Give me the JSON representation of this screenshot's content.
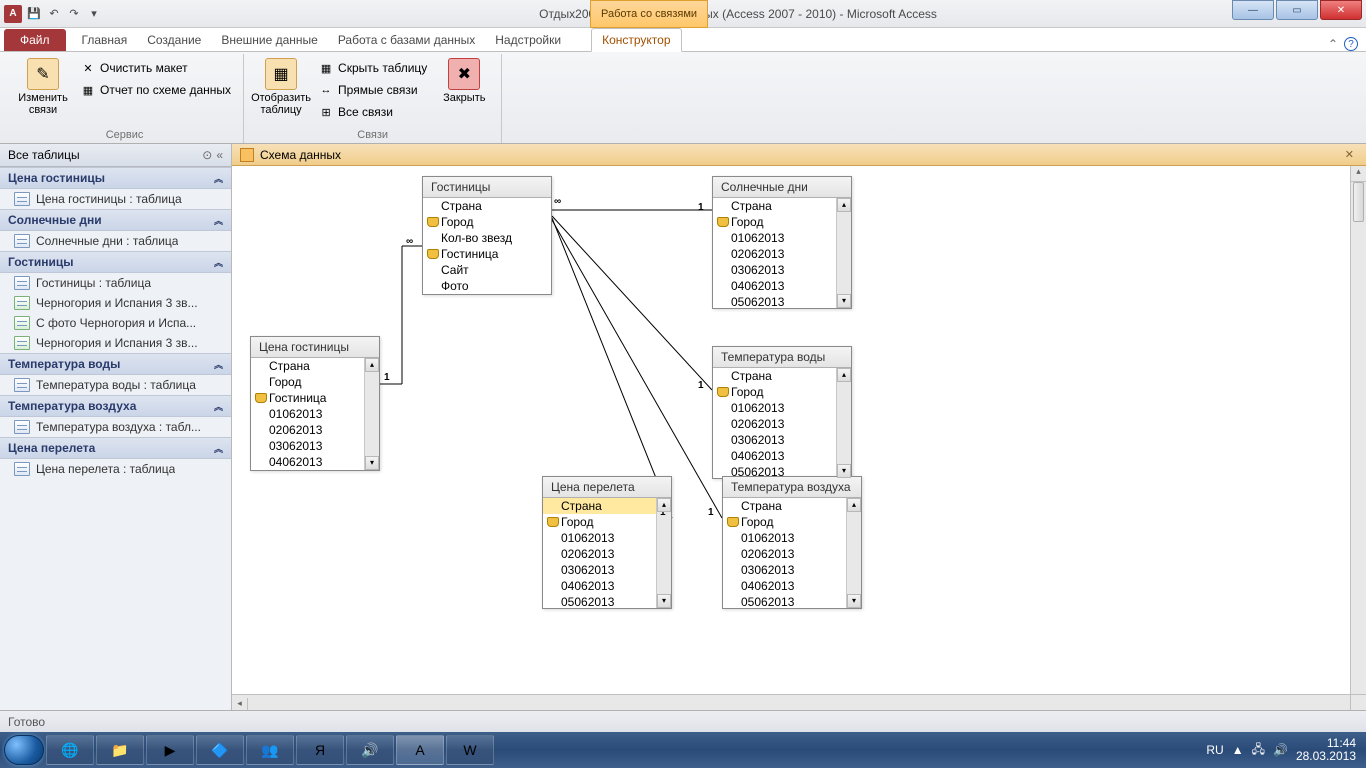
{
  "titlebar": {
    "app_letter": "A",
    "title": "Отдых2007 28_03 : база данных (Access 2007 - 2010)  -  Microsoft Access",
    "context_group": "Работа со связями"
  },
  "win_controls": {
    "min": "—",
    "max": "▭",
    "close": "✕"
  },
  "ribbon_tabs": {
    "file": "Файл",
    "tabs": [
      "Главная",
      "Создание",
      "Внешние данные",
      "Работа с базами данных",
      "Надстройки"
    ],
    "active": "Конструктор"
  },
  "ribbon": {
    "group1_label": "Сервис",
    "edit_rel": "Изменить\nсвязи",
    "clear_layout": "Очистить макет",
    "rel_report": "Отчет по схеме данных",
    "group2_label": "Связи",
    "show_table": "Отобразить\nтаблицу",
    "hide_table": "Скрыть таблицу",
    "direct_rel": "Прямые связи",
    "all_rel": "Все связи",
    "close": "Закрыть"
  },
  "navpane": {
    "header": "Все таблицы",
    "groups": [
      {
        "title": "Цена гостиницы",
        "items": [
          {
            "t": "t",
            "label": "Цена гостиницы : таблица"
          }
        ]
      },
      {
        "title": "Солнечные дни",
        "items": [
          {
            "t": "t",
            "label": "Солнечные дни : таблица"
          }
        ]
      },
      {
        "title": "Гостиницы",
        "items": [
          {
            "t": "t",
            "label": "Гостиницы : таблица"
          },
          {
            "t": "q",
            "label": "Черногория и Испания 3 зв..."
          },
          {
            "t": "q",
            "label": "С фото Черногория и Испа..."
          },
          {
            "t": "q",
            "label": "Черногория и Испания 3 зв..."
          }
        ]
      },
      {
        "title": "Температура воды",
        "items": [
          {
            "t": "t",
            "label": "Температура воды : таблица"
          }
        ]
      },
      {
        "title": "Температура воздуха",
        "items": [
          {
            "t": "t",
            "label": "Температура воздуха : табл..."
          }
        ]
      },
      {
        "title": "Цена перелета",
        "items": [
          {
            "t": "t",
            "label": "Цена перелета : таблица"
          }
        ]
      }
    ]
  },
  "doc_tab": "Схема данных",
  "tables": {
    "hostels": {
      "title": "Гостиницы",
      "fields": [
        {
          "n": "Страна",
          "k": false
        },
        {
          "n": "Город",
          "k": true
        },
        {
          "n": "Кол-во звезд",
          "k": false
        },
        {
          "n": "Гостиница",
          "k": true
        },
        {
          "n": "Сайт",
          "k": false
        },
        {
          "n": "Фото",
          "k": false
        }
      ]
    },
    "sunny": {
      "title": "Солнечные дни",
      "fields": [
        {
          "n": "Страна",
          "k": false
        },
        {
          "n": "Город",
          "k": true
        },
        {
          "n": "01062013",
          "k": false
        },
        {
          "n": "02062013",
          "k": false
        },
        {
          "n": "03062013",
          "k": false
        },
        {
          "n": "04062013",
          "k": false
        },
        {
          "n": "05062013",
          "k": false
        }
      ]
    },
    "price": {
      "title": "Цена гостиницы",
      "fields": [
        {
          "n": "Страна",
          "k": false
        },
        {
          "n": "Город",
          "k": false
        },
        {
          "n": "Гостиница",
          "k": true
        },
        {
          "n": "01062013",
          "k": false
        },
        {
          "n": "02062013",
          "k": false
        },
        {
          "n": "03062013",
          "k": false
        },
        {
          "n": "04062013",
          "k": false
        }
      ]
    },
    "water": {
      "title": "Температура воды",
      "fields": [
        {
          "n": "Страна",
          "k": false
        },
        {
          "n": "Город",
          "k": true
        },
        {
          "n": "01062013",
          "k": false
        },
        {
          "n": "02062013",
          "k": false
        },
        {
          "n": "03062013",
          "k": false
        },
        {
          "n": "04062013",
          "k": false
        },
        {
          "n": "05062013",
          "k": false
        }
      ]
    },
    "flight": {
      "title": "Цена перелета",
      "fields": [
        {
          "n": "Страна",
          "k": false,
          "sel": true
        },
        {
          "n": "Город",
          "k": true
        },
        {
          "n": "01062013",
          "k": false
        },
        {
          "n": "02062013",
          "k": false
        },
        {
          "n": "03062013",
          "k": false
        },
        {
          "n": "04062013",
          "k": false
        },
        {
          "n": "05062013",
          "k": false
        }
      ]
    },
    "air": {
      "title": "Температура воздуха",
      "fields": [
        {
          "n": "Страна",
          "k": false
        },
        {
          "n": "Город",
          "k": true
        },
        {
          "n": "01062013",
          "k": false
        },
        {
          "n": "02062013",
          "k": false
        },
        {
          "n": "03062013",
          "k": false
        },
        {
          "n": "04062013",
          "k": false
        },
        {
          "n": "05062013",
          "k": false
        }
      ]
    }
  },
  "rel_labels": {
    "one": "1",
    "many": "∞"
  },
  "status": "Готово",
  "tray": {
    "lang": "RU",
    "time": "11:44",
    "date": "28.03.2013"
  }
}
